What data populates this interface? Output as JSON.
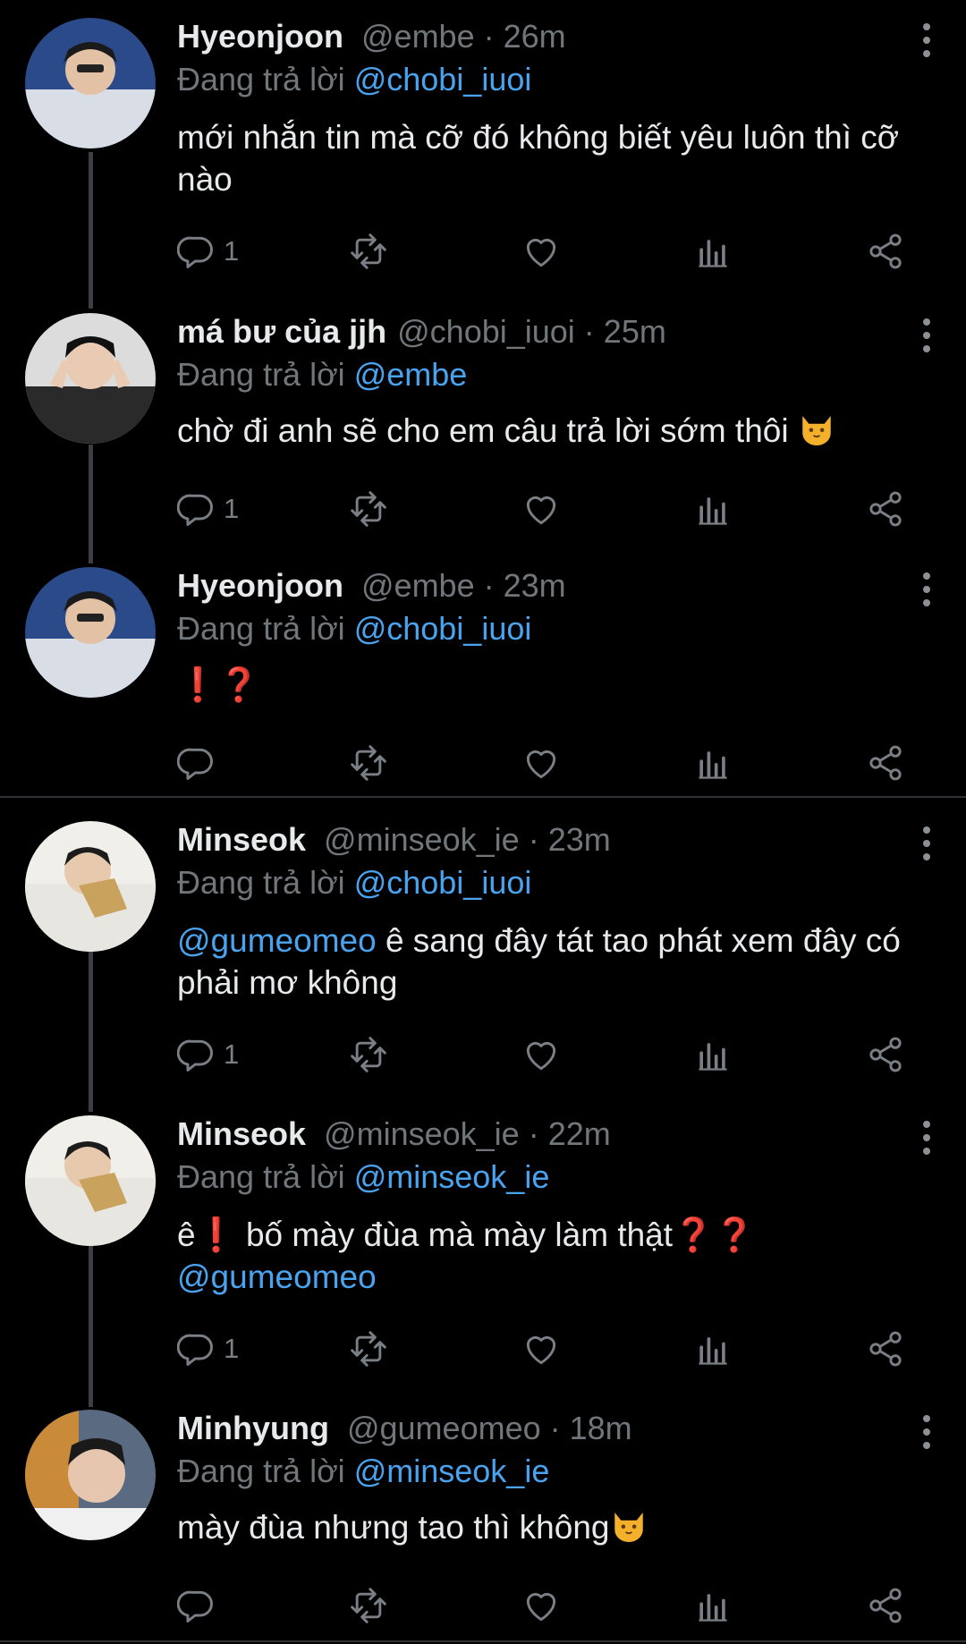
{
  "replying_label": "Đang trả lời",
  "colors": {
    "background": "#000000",
    "mention": "#4aa3ef",
    "muted": "#71767b",
    "thread_line": "#3b3f44"
  },
  "tweets": [
    {
      "name": "Hyeonjoon",
      "handle": "@embe",
      "sep": "·",
      "time": "26m",
      "replying_to": "@chobi_iuoi",
      "text": "mới nhắn tin mà cỡ đó không biết yêu luôn thì cỡ nào",
      "reply_count": "1"
    },
    {
      "name": "má bư của jjh",
      "handle": "@chobi_iuoi",
      "sep": "·",
      "time": "25m",
      "replying_to": "@embe",
      "text": "chờ đi anh sẽ cho em câu trả lời sớm thôi",
      "reply_count": "1"
    },
    {
      "name": "Hyeonjoon",
      "handle": "@embe",
      "sep": "·",
      "time": "23m",
      "replying_to": "@chobi_iuoi",
      "text_exclaim": "❗",
      "text_question": "❓",
      "reply_count": ""
    },
    {
      "name": "Minseok",
      "handle": "@minseok_ie",
      "sep": "·",
      "time": "23m",
      "replying_to": "@chobi_iuoi",
      "text_mention": "@gumeomeo",
      "text": "ê sang đây tát tao phát xem đây có phải mơ không",
      "reply_count": "1"
    },
    {
      "name": "Minseok",
      "handle": "@minseok_ie",
      "sep": "·",
      "time": "22m",
      "replying_to": "@minseok_ie",
      "text_a": "ê",
      "text_exclaim": "❗",
      "text_b": "bố mày đùa mà mày làm thật",
      "text_question": "❓❓",
      "text_mention": "@gumeomeo",
      "reply_count": "1"
    },
    {
      "name": "Minhyung",
      "handle": "@gumeomeo",
      "sep": "·",
      "time": "18m",
      "replying_to": "@minseok_ie",
      "text": "mày đùa nhưng tao thì không",
      "reply_count": ""
    }
  ]
}
